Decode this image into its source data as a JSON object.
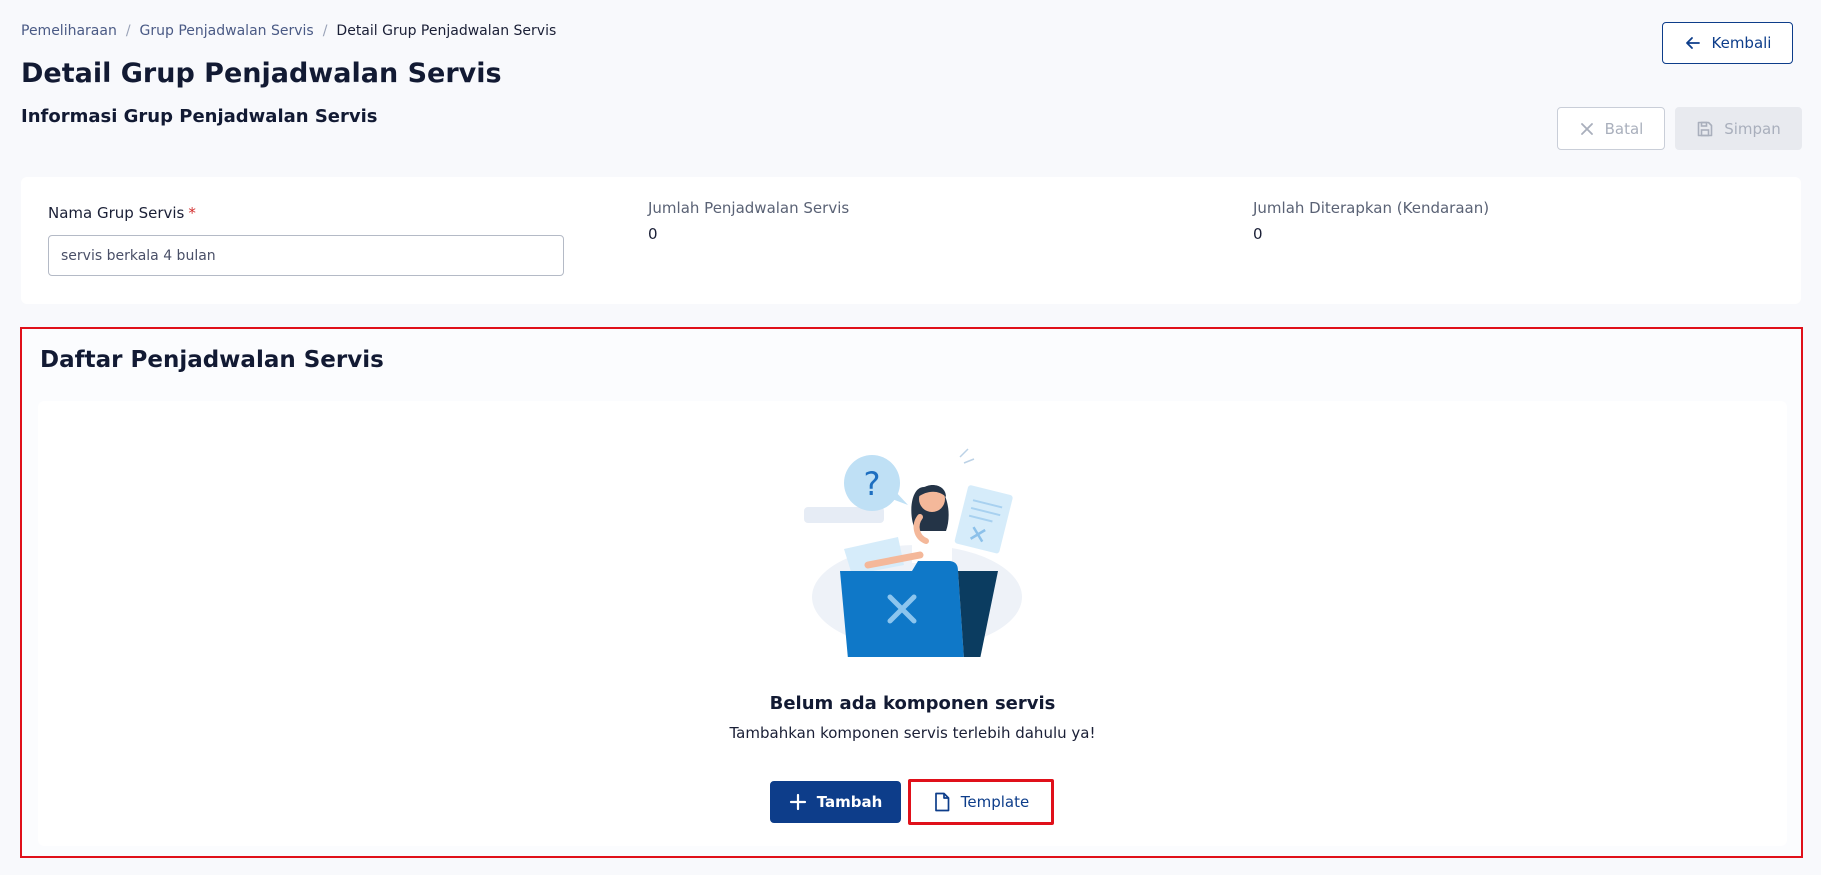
{
  "breadcrumb": {
    "items": [
      "Pemeliharaan",
      "Grup Penjadwalan Servis"
    ],
    "current": "Detail Grup Penjadwalan Servis",
    "separator": "/"
  },
  "header": {
    "title": "Detail Grup Penjadwalan Servis",
    "subtitle": "Informasi Grup Penjadwalan Servis",
    "back_label": "Kembali",
    "cancel_label": "Batal",
    "save_label": "Simpan"
  },
  "info": {
    "name_label": "Nama Grup Servis",
    "required_mark": "*",
    "name_value": "servis berkala 4 bulan",
    "schedule_count_label": "Jumlah Penjadwalan Servis",
    "schedule_count_value": "0",
    "applied_count_label": "Jumlah Diterapkan (Kendaraan)",
    "applied_count_value": "0"
  },
  "list": {
    "title": "Daftar Penjadwalan Servis",
    "empty_title": "Belum ada komponen servis",
    "empty_desc": "Tambahkan komponen servis terlebih dahulu ya!",
    "add_label": "Tambah",
    "template_label": "Template"
  },
  "icons": {
    "back": "arrow-left-icon",
    "cancel": "close-icon",
    "save": "save-icon",
    "add": "plus-icon",
    "template": "file-icon"
  },
  "colors": {
    "primary": "#0d3d8a",
    "highlight": "#e0101a",
    "required": "#d32f2f",
    "disabled_text": "#a9afbc"
  }
}
